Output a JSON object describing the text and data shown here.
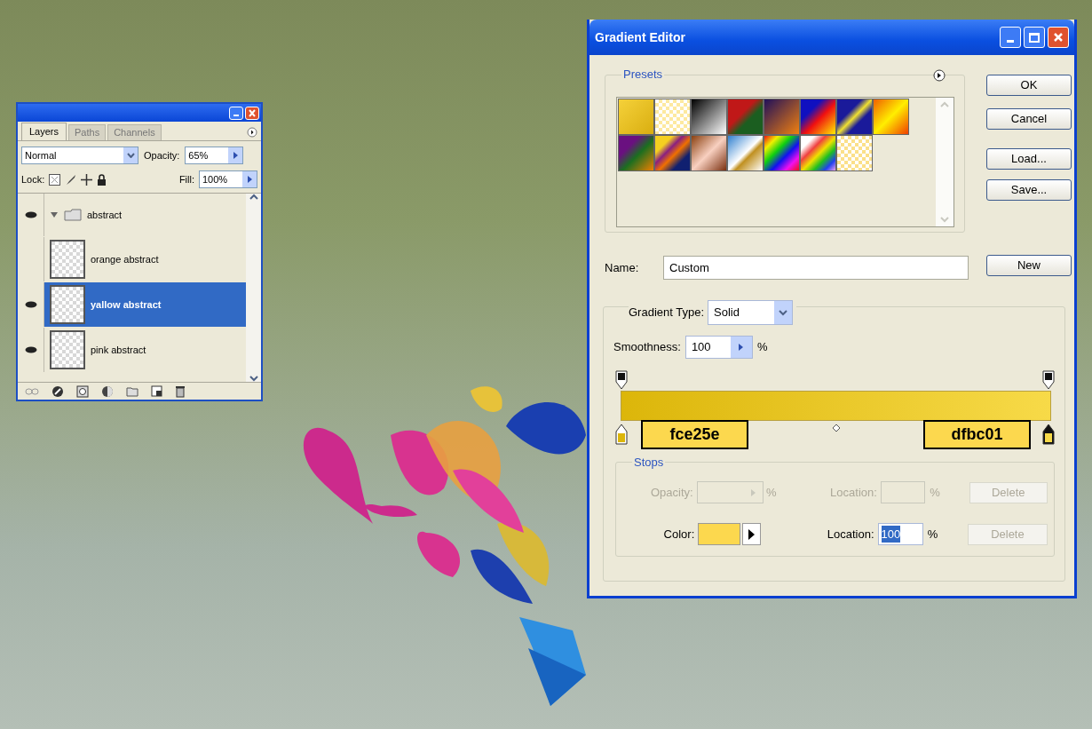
{
  "layers_panel": {
    "tabs": [
      {
        "label": "Layers",
        "selected": true
      },
      {
        "label": "Paths",
        "selected": false
      },
      {
        "label": "Channels",
        "selected": false
      }
    ],
    "blend_mode": "Normal",
    "opacity_label": "Opacity:",
    "opacity": "65%",
    "lock_label": "Lock:",
    "fill_label": "Fill:",
    "fill": "100%",
    "layers": [
      {
        "name": "abstract",
        "kind": "group",
        "visible": true,
        "expanded": true,
        "selected": false,
        "children": [
          {
            "name": "orange abstract",
            "kind": "layer",
            "visible": false,
            "selected": false
          },
          {
            "name": "yallow abstract",
            "kind": "layer",
            "visible": true,
            "selected": true
          },
          {
            "name": "pink abstract",
            "kind": "layer",
            "visible": true,
            "selected": false
          }
        ]
      }
    ]
  },
  "gradient_editor": {
    "title": "Gradient Editor",
    "presets_label": "Presets",
    "buttons": [
      {
        "label": "OK"
      },
      {
        "label": "Cancel"
      },
      {
        "label": "Load..."
      },
      {
        "label": "Save..."
      }
    ],
    "name_label": "Name:",
    "name_value": "Custom",
    "new_button": "New",
    "gradient_type_label": "Gradient Type:",
    "gradient_type": "Solid",
    "smoothness_label": "Smoothness:",
    "smoothness": "100",
    "smoothness_unit": "%",
    "color_stops": [
      {
        "color": "#dcb60a",
        "selected": false
      },
      {
        "color": "#f7da48",
        "selected": true
      }
    ],
    "callouts": [
      "fce25e",
      "dfbc01"
    ],
    "stops": {
      "label": "Stops",
      "rows": [
        {
          "kind": "opacity",
          "label": "Opacity:",
          "unit": "%",
          "location_label": "Location:",
          "location_unit": "%",
          "delete": "Delete",
          "delete_disabled": true,
          "disabled": true
        },
        {
          "kind": "color",
          "label": "Color:",
          "color": "#fcd84e",
          "location_label": "Location:",
          "location": "100",
          "location_unit": "%",
          "delete": "Delete",
          "delete_disabled": true,
          "disabled": false
        }
      ]
    }
  }
}
